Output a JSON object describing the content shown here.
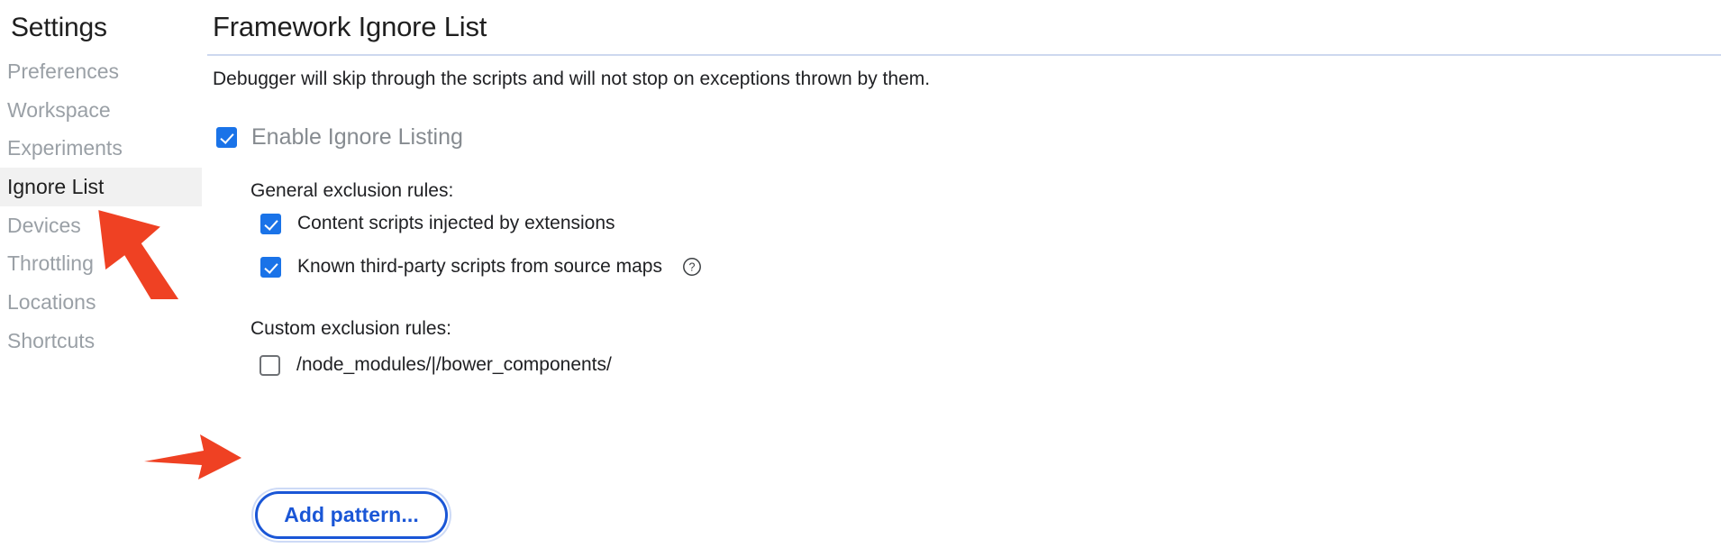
{
  "sidebar": {
    "title": "Settings",
    "items": [
      {
        "label": "Preferences",
        "selected": false
      },
      {
        "label": "Workspace",
        "selected": false
      },
      {
        "label": "Experiments",
        "selected": false
      },
      {
        "label": "Ignore List",
        "selected": true
      },
      {
        "label": "Devices",
        "selected": false
      },
      {
        "label": "Throttling",
        "selected": false
      },
      {
        "label": "Locations",
        "selected": false
      },
      {
        "label": "Shortcuts",
        "selected": false
      }
    ]
  },
  "main": {
    "page_title": "Framework Ignore List",
    "description": "Debugger will skip through the scripts and will not stop on exceptions thrown by them.",
    "enable_ignore_listing": {
      "label": "Enable Ignore Listing",
      "checked": true
    },
    "general_rules": {
      "heading": "General exclusion rules:",
      "items": [
        {
          "label": "Content scripts injected by extensions",
          "checked": true,
          "help": false
        },
        {
          "label": "Known third-party scripts from source maps",
          "checked": true,
          "help": true
        }
      ]
    },
    "custom_rules": {
      "heading": "Custom exclusion rules:",
      "items": [
        {
          "label": "/node_modules/|/bower_components/",
          "checked": false
        }
      ],
      "add_button_label": "Add pattern..."
    },
    "help_icon_name": "help-question-circle-icon"
  },
  "annotations": {
    "arrow_color": "#ef4123",
    "arrows": [
      {
        "name": "arrow-pointing-to-ignore-list",
        "target": "Ignore List"
      },
      {
        "name": "arrow-pointing-to-custom-pattern-checkbox",
        "target": "/node_modules/|/bower_components/"
      }
    ]
  },
  "colors": {
    "accent_blue": "#1a73e8",
    "button_blue": "#1a56d6",
    "selected_row_bg": "#f1f1f1",
    "divider": "#cdd8ef",
    "muted_text": "#9aa0a6",
    "body_text": "#202124"
  }
}
